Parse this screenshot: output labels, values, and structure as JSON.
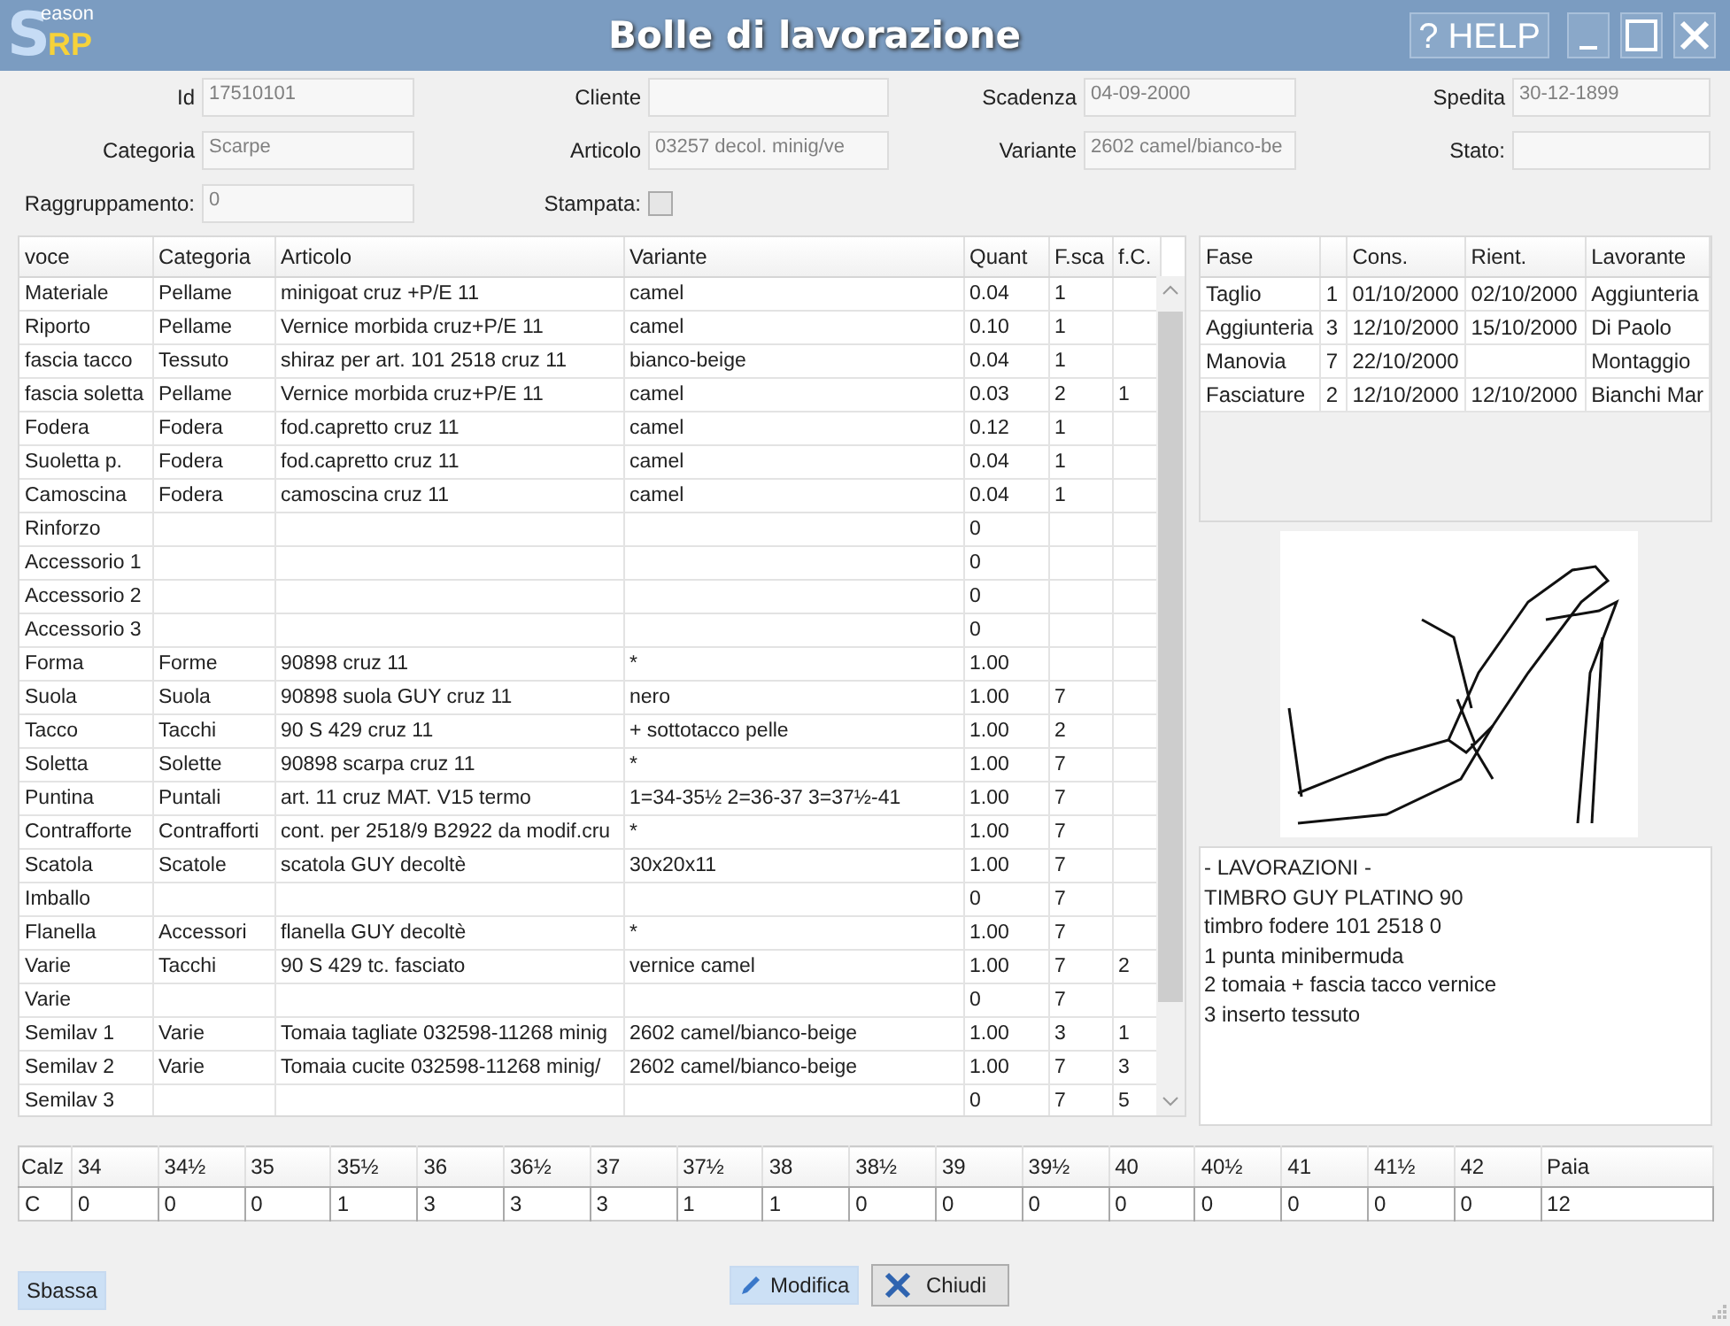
{
  "window": {
    "logo": {
      "initial": "S",
      "small": "eason",
      "rest": "RP"
    },
    "title": "Bolle di lavorazione",
    "help": "? HELP"
  },
  "form": {
    "rows": [
      [
        {
          "label": "Id",
          "value": "17510101",
          "kind": "text"
        },
        {
          "label": "Cliente",
          "kind": "text"
        },
        {
          "label": "Scadenza",
          "value": "04-09-2000",
          "kind": "text"
        },
        {
          "label": "Spedita",
          "value": "30-12-1899",
          "kind": "text"
        }
      ],
      [
        {
          "label": "Categoria",
          "value": "Scarpe",
          "kind": "text"
        },
        {
          "label": "Articolo",
          "value": "03257 decol. minig/ve",
          "kind": "text"
        },
        {
          "label": "Variante",
          "value": "2602 camel/bianco-be",
          "kind": "text"
        },
        {
          "label": "Stato:",
          "kind": "text"
        }
      ],
      [
        {
          "label": "Raggruppamento:",
          "value": "0",
          "kind": "text"
        },
        {
          "label": "Stampata:",
          "checked": false,
          "kind": "checkbox"
        }
      ]
    ]
  },
  "materials": {
    "columns": [
      "voce",
      "Categoria",
      "Articolo",
      "Variante",
      "Quant",
      "F.sca",
      "f.C."
    ],
    "rows": [
      [
        "Materiale",
        "Pellame",
        "minigoat cruz +P/E 11",
        "camel",
        "0.04",
        "1",
        ""
      ],
      [
        "Riporto",
        "Pellame",
        "Vernice morbida cruz+P/E 11",
        "camel",
        "0.10",
        "1",
        ""
      ],
      [
        "fascia tacco",
        "Tessuto",
        "shiraz per art. 101 2518 cruz 11",
        "bianco-beige",
        "0.04",
        "1",
        ""
      ],
      [
        "fascia soletta",
        "Pellame",
        "Vernice morbida cruz+P/E 11",
        "camel",
        "0.03",
        "2",
        "1"
      ],
      [
        "Fodera",
        "Fodera",
        "fod.capretto cruz 11",
        "camel",
        "0.12",
        "1",
        ""
      ],
      [
        "Suoletta p.",
        "Fodera",
        "fod.capretto cruz 11",
        "camel",
        "0.04",
        "1",
        ""
      ],
      [
        "Camoscina",
        "Fodera",
        "camoscina cruz 11",
        "camel",
        "0.04",
        "1",
        ""
      ],
      [
        "Rinforzo",
        "",
        "",
        "",
        "0",
        "",
        ""
      ],
      [
        "Accessorio 1",
        "",
        "",
        "",
        "0",
        "",
        ""
      ],
      [
        "Accessorio 2",
        "",
        "",
        "",
        "0",
        "",
        ""
      ],
      [
        "Accessorio 3",
        "",
        "",
        "",
        "0",
        "",
        ""
      ],
      [
        "Forma",
        "Forme",
        "90898 cruz 11",
        "*",
        "1.00",
        "",
        ""
      ],
      [
        "Suola",
        "Suola",
        "90898 suola GUY cruz 11",
        "nero",
        "1.00",
        "7",
        ""
      ],
      [
        "Tacco",
        "Tacchi",
        "90 S 429 cruz 11",
        "+ sottotacco pelle",
        "1.00",
        "2",
        ""
      ],
      [
        "Soletta",
        "Solette",
        "90898 scarpa cruz 11",
        "*",
        "1.00",
        "7",
        ""
      ],
      [
        "Puntina",
        "Puntali",
        "art. 11 cruz  MAT. V15 termo",
        "1=34-35½  2=36-37 3=37½-41",
        "1.00",
        "7",
        ""
      ],
      [
        "Contrafforte",
        "Contrafforti",
        "cont. per 2518/9 B2922 da modif.cru",
        "*",
        "1.00",
        "7",
        ""
      ],
      [
        "Scatola",
        "Scatole",
        "scatola GUY decoltè",
        "30x20x11",
        "1.00",
        "7",
        ""
      ],
      [
        "Imballo",
        "",
        "",
        "",
        "0",
        "7",
        ""
      ],
      [
        "Flanella",
        "Accessori",
        "flanella GUY decoltè",
        "*",
        "1.00",
        "7",
        ""
      ],
      [
        "Varie",
        "Tacchi",
        "90 S 429 tc. fasciato",
        "vernice camel",
        "1.00",
        "7",
        "2"
      ],
      [
        "Varie",
        "",
        "",
        "",
        "0",
        "7",
        ""
      ],
      [
        "Semilav 1",
        "Varie",
        "Tomaia tagliate 032598-11268 minig",
        "2602 camel/bianco-beige",
        "1.00",
        "3",
        "1"
      ],
      [
        "Semilav 2",
        "Varie",
        "Tomaia cucite 032598-11268 minig/",
        "2602 camel/bianco-beige",
        "1.00",
        "7",
        "3"
      ],
      [
        "Semilav 3",
        "",
        "",
        "",
        "0",
        "7",
        "5"
      ]
    ]
  },
  "phases": {
    "columns": [
      "Fase",
      "",
      "Cons.",
      "Rient.",
      "Lavorante"
    ],
    "rows": [
      [
        "Taglio",
        "1",
        "01/10/2000",
        "02/10/2000",
        "Aggiunteria"
      ],
      [
        "Aggiunteria",
        "3",
        "12/10/2000",
        "15/10/2000",
        "Di Paolo"
      ],
      [
        "Manovia",
        "7",
        "22/10/2000",
        "",
        "Montaggio"
      ],
      [
        "Fasciature",
        "2",
        "12/10/2000",
        "12/10/2000",
        "Bianchi Mar"
      ]
    ]
  },
  "notes": [
    "- LAVORAZIONI -",
    "TIMBRO GUY PLATINO 90",
    "timbro fodere 101 2518 0",
    "1 punta minibermuda",
    "2 tomaia + fascia tacco vernice",
    "3 inserto tessuto"
  ],
  "sizes": {
    "columns": [
      "Calz",
      "34",
      "34½",
      "35",
      "35½",
      "36",
      "36½",
      "37",
      "37½",
      "38",
      "38½",
      "39",
      "39½",
      "40",
      "40½",
      "41",
      "41½",
      "42",
      "Paia"
    ],
    "row": [
      "C",
      "0",
      "0",
      "0",
      "1",
      "3",
      "3",
      "3",
      "1",
      "1",
      "0",
      "0",
      "0",
      "0",
      "0",
      "0",
      "0",
      "0",
      "12"
    ]
  },
  "buttons": {
    "lower": "Sbassa",
    "edit": "Modifica",
    "close": "Chiudi"
  }
}
